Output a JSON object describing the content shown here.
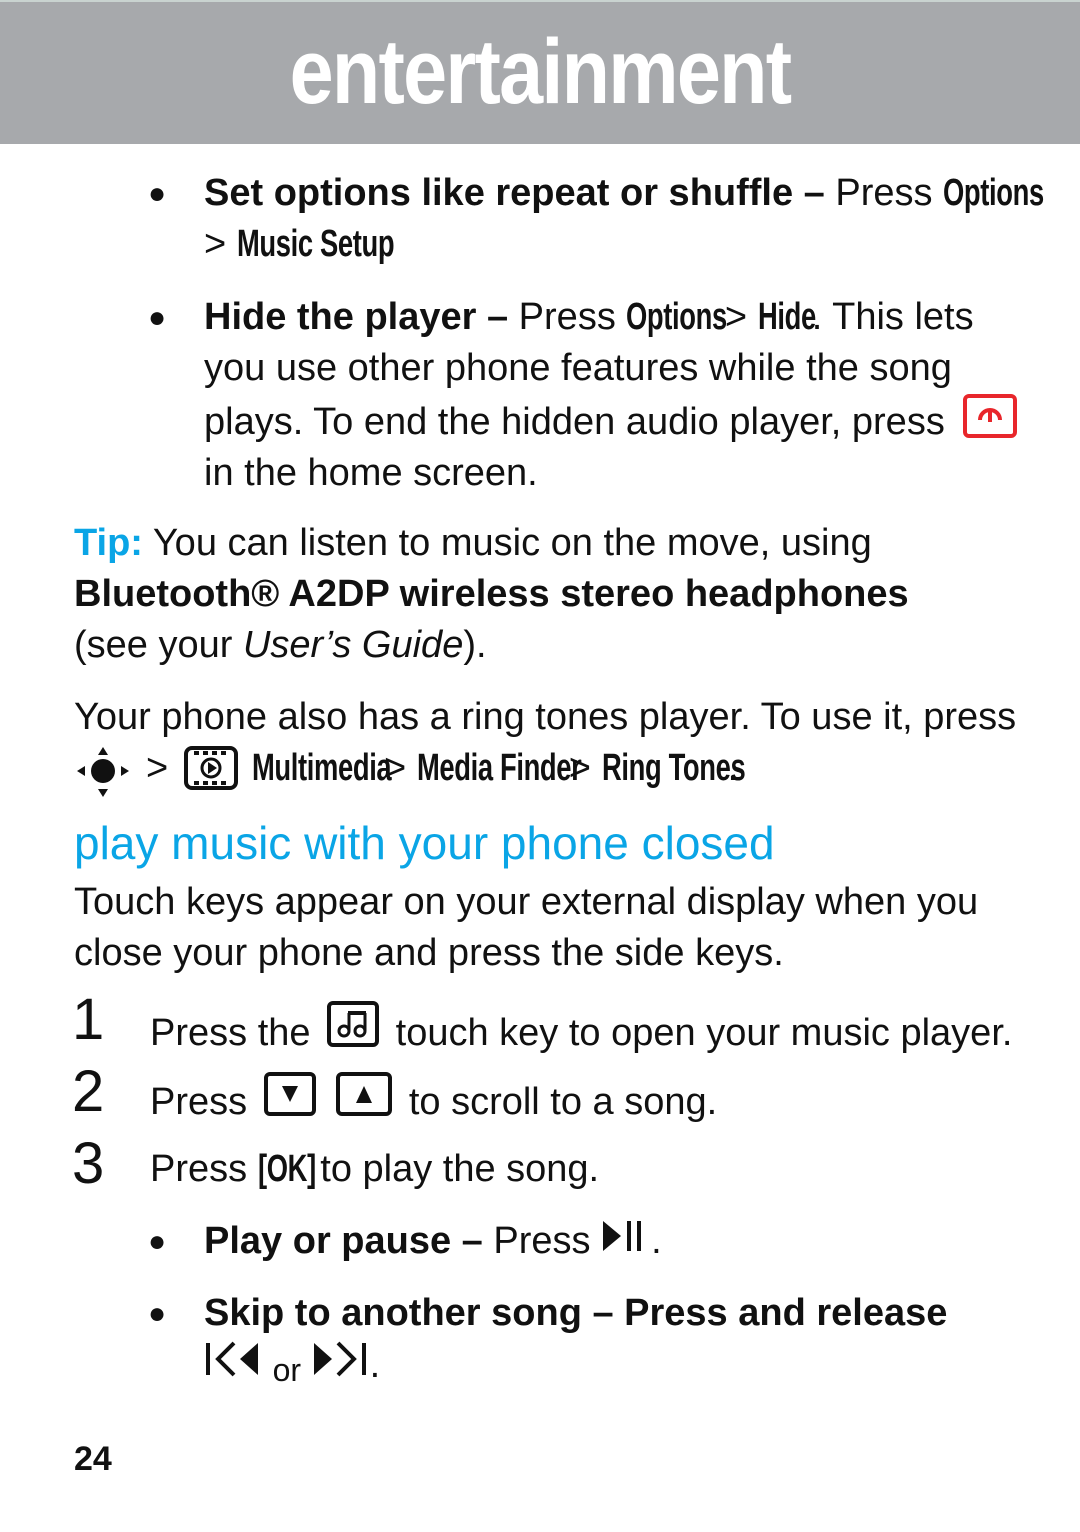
{
  "header": {
    "title": "entertainment"
  },
  "bullets_top": [
    {
      "bold": "Set options like repeat or shuffle –",
      "text_before": " Press ",
      "menu_1": "Options",
      "sep": " > ",
      "menu_2": "Music Setup",
      "end": "."
    },
    {
      "bold": "Hide the player –",
      "text_before": " Press ",
      "menu_1": "Options",
      "sep": " > ",
      "menu_2": "Hide",
      "line1_after": ". This lets",
      "line2": "you use other phone features while the song",
      "line3": "plays. To end the hidden audio player, press",
      "line4": "in the home screen.",
      "key_icon": "power-end-key-icon",
      "key_color": "#e8262b"
    }
  ],
  "tip": {
    "label": "Tip:",
    "line1": " You can listen to music on the move, using",
    "line2_bold": "Bluetooth® A2DP wireless stereo headphones",
    "line3_before": "(see your ",
    "line3_italic": "User’s Guide",
    "line3_after": ")."
  },
  "ringtones": {
    "line1": "Your phone also has a ring tones player. To use it, press",
    "nav_icon": "nav-key-center-icon",
    "sep": ">",
    "multimedia_icon": "multimedia-icon",
    "path": [
      "Multimedia",
      "Media Finder",
      "Ring Tones"
    ],
    "end": "."
  },
  "section": {
    "heading": "play music with your phone closed",
    "intro_line1": "Touch keys appear on your external display when you",
    "intro_line2": "close your phone and press the side keys."
  },
  "steps": [
    {
      "num": "1",
      "before": "Press the",
      "icon": "music-touch-key-icon",
      "after": "touch key to open your music player."
    },
    {
      "num": "2",
      "before": "Press",
      "icons": [
        "down-key-icon",
        "up-key-icon"
      ],
      "after": "to scroll to a song."
    },
    {
      "num": "3",
      "before": "Press ",
      "key": "[OK]",
      "after": " to play the song."
    }
  ],
  "bullets_bottom": [
    {
      "bold": "Play or pause –",
      "text": " Press ",
      "icon": "play-pause-icon",
      "end": "."
    },
    {
      "bold": "Skip to another song – Press and release",
      "icon_prev": "previous-track-icon",
      "or": "or",
      "icon_next": "next-track-icon",
      "end": "."
    }
  ],
  "footer": {
    "page_number": "24"
  }
}
